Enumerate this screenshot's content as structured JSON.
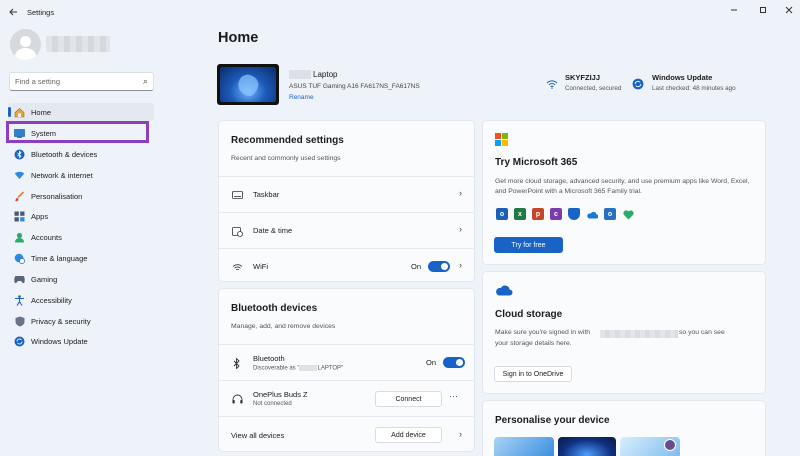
{
  "window": {
    "title": "Settings"
  },
  "sidebar": {
    "search_placeholder": "Find a setting",
    "items": [
      {
        "label": "Home",
        "icon": "home-icon",
        "active": true
      },
      {
        "label": "System",
        "icon": "system-icon"
      },
      {
        "label": "Bluetooth & devices",
        "icon": "bluetooth-icon"
      },
      {
        "label": "Network & internet",
        "icon": "wifi-icon"
      },
      {
        "label": "Personalisation",
        "icon": "brush-icon"
      },
      {
        "label": "Apps",
        "icon": "apps-icon"
      },
      {
        "label": "Accounts",
        "icon": "accounts-icon"
      },
      {
        "label": "Time & language",
        "icon": "globe-clock-icon"
      },
      {
        "label": "Gaming",
        "icon": "gamepad-icon"
      },
      {
        "label": "Accessibility",
        "icon": "accessibility-icon"
      },
      {
        "label": "Privacy & security",
        "icon": "shield-icon"
      },
      {
        "label": "Windows Update",
        "icon": "update-icon"
      }
    ]
  },
  "main": {
    "title": "Home",
    "device": {
      "name": "Laptop",
      "model": "ASUS TUF Gaming A16 FA617NS_FA617NS",
      "rename": "Rename"
    },
    "network": {
      "title": "SKYFZIJJ",
      "subtitle": "Connected, secured"
    },
    "update": {
      "title": "Windows Update",
      "subtitle": "Last checked: 48 minutes ago"
    },
    "recommended": {
      "title": "Recommended settings",
      "subtitle": "Recent and commonly used settings",
      "rows": [
        {
          "label": "Taskbar"
        },
        {
          "label": "Date & time"
        },
        {
          "label": "WiFi",
          "state": "On"
        }
      ]
    },
    "bluetooth": {
      "title": "Bluetooth devices",
      "subtitle": "Manage, add, and remove devices",
      "bt_label": "Bluetooth",
      "bt_sub": "Discoverable as \"",
      "bt_sub_end": "LAPTOP\"",
      "bt_state": "On",
      "device_name": "OnePlus Buds Z",
      "device_status": "Not connected",
      "connect_label": "Connect",
      "view_all": "View all devices",
      "add_device": "Add device"
    },
    "m365": {
      "title": "Try Microsoft 365",
      "desc": "Get more cloud storage, advanced security, and use premium apps like Word, Excel, and PowerPoint with a Microsoft 365 Family trial.",
      "button": "Try for free"
    },
    "cloud": {
      "title": "Cloud storage",
      "desc_a": "Make sure you're signed in with",
      "desc_b": "so you can see",
      "desc_c": "your storage details here.",
      "button": "Sign in to OneDrive"
    },
    "personalise": {
      "title": "Personalise your device"
    }
  },
  "colors": {
    "accent": "#1a63c6",
    "highlight": "#8e3fc0"
  }
}
